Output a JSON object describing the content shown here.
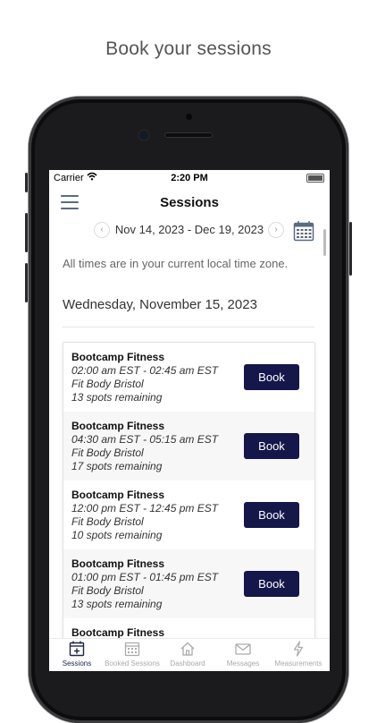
{
  "headline": "Book your sessions",
  "status": {
    "carrier": "Carrier",
    "time": "2:20 PM"
  },
  "nav": {
    "title": "Sessions"
  },
  "date_range": "Nov 14, 2023 - Dec 19, 2023",
  "timezone_note": "All times are in your current local time zone.",
  "day_heading": "Wednesday, November 15, 2023",
  "sessions": [
    {
      "name": "Bootcamp Fitness",
      "time": "02:00 am EST - 02:45 am EST",
      "location": "Fit Body Bristol",
      "spots": "13 spots remaining",
      "action": "Book"
    },
    {
      "name": "Bootcamp Fitness",
      "time": "04:30 am EST - 05:15 am EST",
      "location": "Fit Body Bristol",
      "spots": "17 spots remaining",
      "action": "Book"
    },
    {
      "name": "Bootcamp Fitness",
      "time": "12:00 pm EST - 12:45 pm EST",
      "location": "Fit Body Bristol",
      "spots": "10 spots remaining",
      "action": "Book"
    },
    {
      "name": "Bootcamp Fitness",
      "time": "01:00 pm EST - 01:45 pm EST",
      "location": "Fit Body Bristol",
      "spots": "13 spots remaining",
      "action": "Book"
    },
    {
      "name": "Bootcamp Fitness"
    }
  ],
  "tabs": [
    {
      "label": "Sessions",
      "icon": "calendar-plus-icon",
      "active": true
    },
    {
      "label": "Booked Sessions",
      "icon": "calendar-grid-icon",
      "active": false
    },
    {
      "label": "Dashboard",
      "icon": "home-icon",
      "active": false
    },
    {
      "label": "Messages",
      "icon": "envelope-icon",
      "active": false
    },
    {
      "label": "Measurements",
      "icon": "bolt-icon",
      "active": false
    }
  ],
  "colors": {
    "book_button": "#15174a",
    "active_tab": "#1c2350",
    "inactive_tab": "#aaaaaa"
  }
}
